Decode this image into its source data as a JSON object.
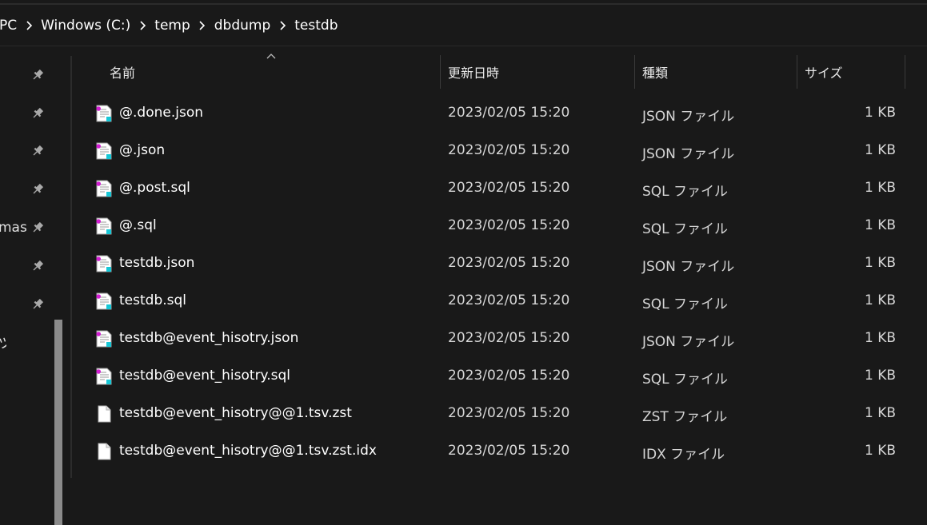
{
  "breadcrumb": [
    "PC",
    "Windows (C:)",
    "temp",
    "dbdump",
    "testdb"
  ],
  "nav": {
    "truncated_labels": [
      "mast",
      "ヅ"
    ]
  },
  "columns": {
    "name": "名前",
    "modified": "更新日時",
    "type": "種類",
    "size": "サイズ"
  },
  "files": [
    {
      "name": "@.done.json",
      "modified": "2023/02/05 15:20",
      "type": "JSON ファイル",
      "size": "1 KB",
      "icon": "script-file-icon"
    },
    {
      "name": "@.json",
      "modified": "2023/02/05 15:20",
      "type": "JSON ファイル",
      "size": "1 KB",
      "icon": "script-file-icon"
    },
    {
      "name": "@.post.sql",
      "modified": "2023/02/05 15:20",
      "type": "SQL ファイル",
      "size": "1 KB",
      "icon": "script-file-icon"
    },
    {
      "name": "@.sql",
      "modified": "2023/02/05 15:20",
      "type": "SQL ファイル",
      "size": "1 KB",
      "icon": "script-file-icon"
    },
    {
      "name": "testdb.json",
      "modified": "2023/02/05 15:20",
      "type": "JSON ファイル",
      "size": "1 KB",
      "icon": "script-file-icon"
    },
    {
      "name": "testdb.sql",
      "modified": "2023/02/05 15:20",
      "type": "SQL ファイル",
      "size": "1 KB",
      "icon": "script-file-icon"
    },
    {
      "name": "testdb@event_hisotry.json",
      "modified": "2023/02/05 15:20",
      "type": "JSON ファイル",
      "size": "1 KB",
      "icon": "script-file-icon"
    },
    {
      "name": "testdb@event_hisotry.sql",
      "modified": "2023/02/05 15:20",
      "type": "SQL ファイル",
      "size": "1 KB",
      "icon": "script-file-icon"
    },
    {
      "name": "testdb@event_hisotry@@1.tsv.zst",
      "modified": "2023/02/05 15:20",
      "type": "ZST ファイル",
      "size": "1 KB",
      "icon": "blank-file-icon"
    },
    {
      "name": "testdb@event_hisotry@@1.tsv.zst.idx",
      "modified": "2023/02/05 15:20",
      "type": "IDX ファイル",
      "size": "1 KB",
      "icon": "blank-file-icon"
    }
  ],
  "colors": {
    "background": "#191919",
    "icon_magenta": "#d21ed2",
    "icon_cyan": "#17c7d6"
  }
}
